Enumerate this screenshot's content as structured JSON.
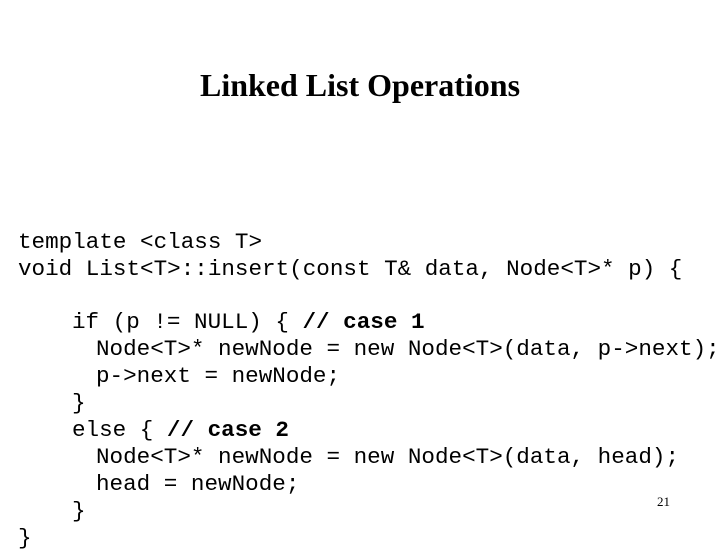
{
  "slide": {
    "title": "Linked List Operations",
    "page_number": "21",
    "background_color": "#ffffff",
    "text_color": "#000000"
  },
  "code": {
    "lines": [
      {
        "indent": 0,
        "text": "template <class T>",
        "comment": ""
      },
      {
        "indent": 0,
        "text": "void List<T>::insert(const T& data, Node<T>* p) {",
        "comment": ""
      },
      {
        "indent": 0,
        "text": "",
        "comment": "",
        "blank": true
      },
      {
        "indent": 54,
        "text": "if (p != NULL) { ",
        "comment": "// case 1"
      },
      {
        "indent": 78,
        "text": "Node<T>* newNode = new Node<T>(data, p->next);",
        "comment": ""
      },
      {
        "indent": 78,
        "text": "p->next = newNode;",
        "comment": ""
      },
      {
        "indent": 54,
        "text": "}",
        "comment": ""
      },
      {
        "indent": 54,
        "text": "else { ",
        "comment": "// case 2"
      },
      {
        "indent": 78,
        "text": "Node<T>* newNode = new Node<T>(data, head);",
        "comment": ""
      },
      {
        "indent": 78,
        "text": "head = newNode;",
        "comment": ""
      },
      {
        "indent": 54,
        "text": "}",
        "comment": ""
      },
      {
        "indent": 0,
        "text": "}",
        "comment": ""
      }
    ]
  }
}
